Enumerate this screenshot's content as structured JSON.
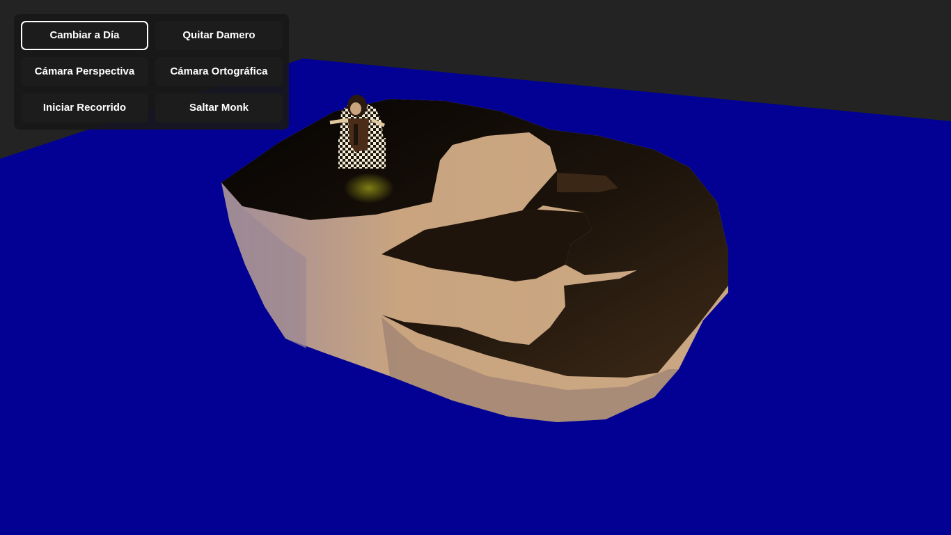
{
  "scene": {
    "colors": {
      "background": "#232323",
      "water": "#020193",
      "terrain_top": "#0b0704",
      "terrain_mid": "#3a2715",
      "cliff_light": "#c9a47f",
      "cliff_dark": "#9a7a61",
      "cliff_shadow": "#7d6a74",
      "checker_light": "#f3ecd7",
      "checker_dark": "#1d140c",
      "monk_robe": "#4a2c18",
      "glow": "#7d7a12"
    },
    "objects": [
      "water-plane",
      "rocky-island",
      "monk-character"
    ]
  },
  "controls": {
    "buttons": [
      {
        "label": "Cambiar a Día",
        "active": true
      },
      {
        "label": "Quitar Damero",
        "active": false
      },
      {
        "label": "Cámara Perspectiva",
        "active": false
      },
      {
        "label": "Cámara Ortográfica",
        "active": false
      },
      {
        "label": "Iniciar Recorrido",
        "active": false
      },
      {
        "label": "Saltar Monk",
        "active": false
      }
    ]
  }
}
